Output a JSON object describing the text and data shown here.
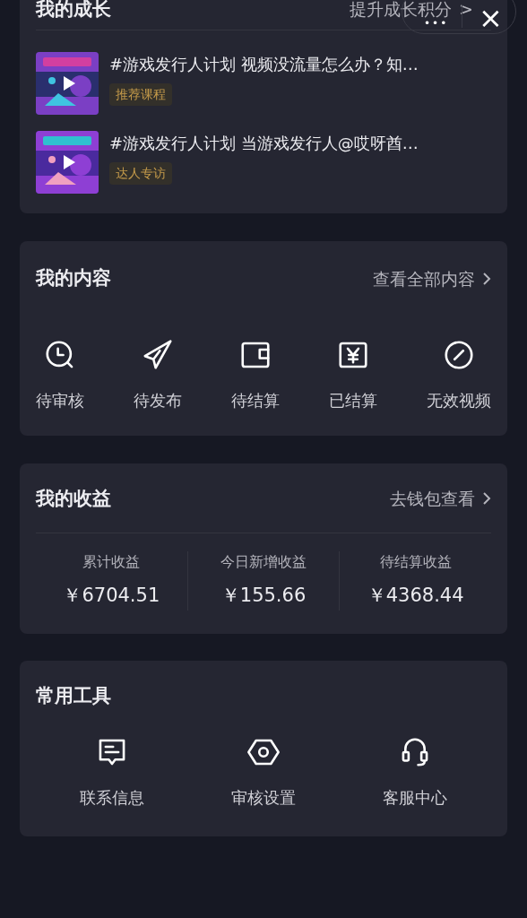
{
  "growth": {
    "title": "我的成长",
    "link": "提升成长积分",
    "link_arrow": ">",
    "items": [
      {
        "title": "#游戏发行人计划 视频没流量怎么办？知…",
        "tag": "推荐课程"
      },
      {
        "title": "#游戏发行人计划 当游戏发行人@哎呀酋…",
        "tag": "达人专访"
      }
    ]
  },
  "capsule": {
    "more": "•••",
    "close": "×"
  },
  "content": {
    "title": "我的内容",
    "link": "查看全部内容",
    "items": [
      {
        "label": "待审核"
      },
      {
        "label": "待发布"
      },
      {
        "label": "待结算"
      },
      {
        "label": "已结算"
      },
      {
        "label": "无效视频"
      }
    ]
  },
  "earnings": {
    "title": "我的收益",
    "link": "去钱包查看",
    "stats": [
      {
        "label": "累计收益",
        "value": "￥6704.51"
      },
      {
        "label": "今日新增收益",
        "value": "￥155.66"
      },
      {
        "label": "待结算收益",
        "value": "￥4368.44"
      }
    ]
  },
  "tools": {
    "title": "常用工具",
    "items": [
      {
        "label": "联系信息"
      },
      {
        "label": "审核设置"
      },
      {
        "label": "客服中心"
      }
    ]
  }
}
